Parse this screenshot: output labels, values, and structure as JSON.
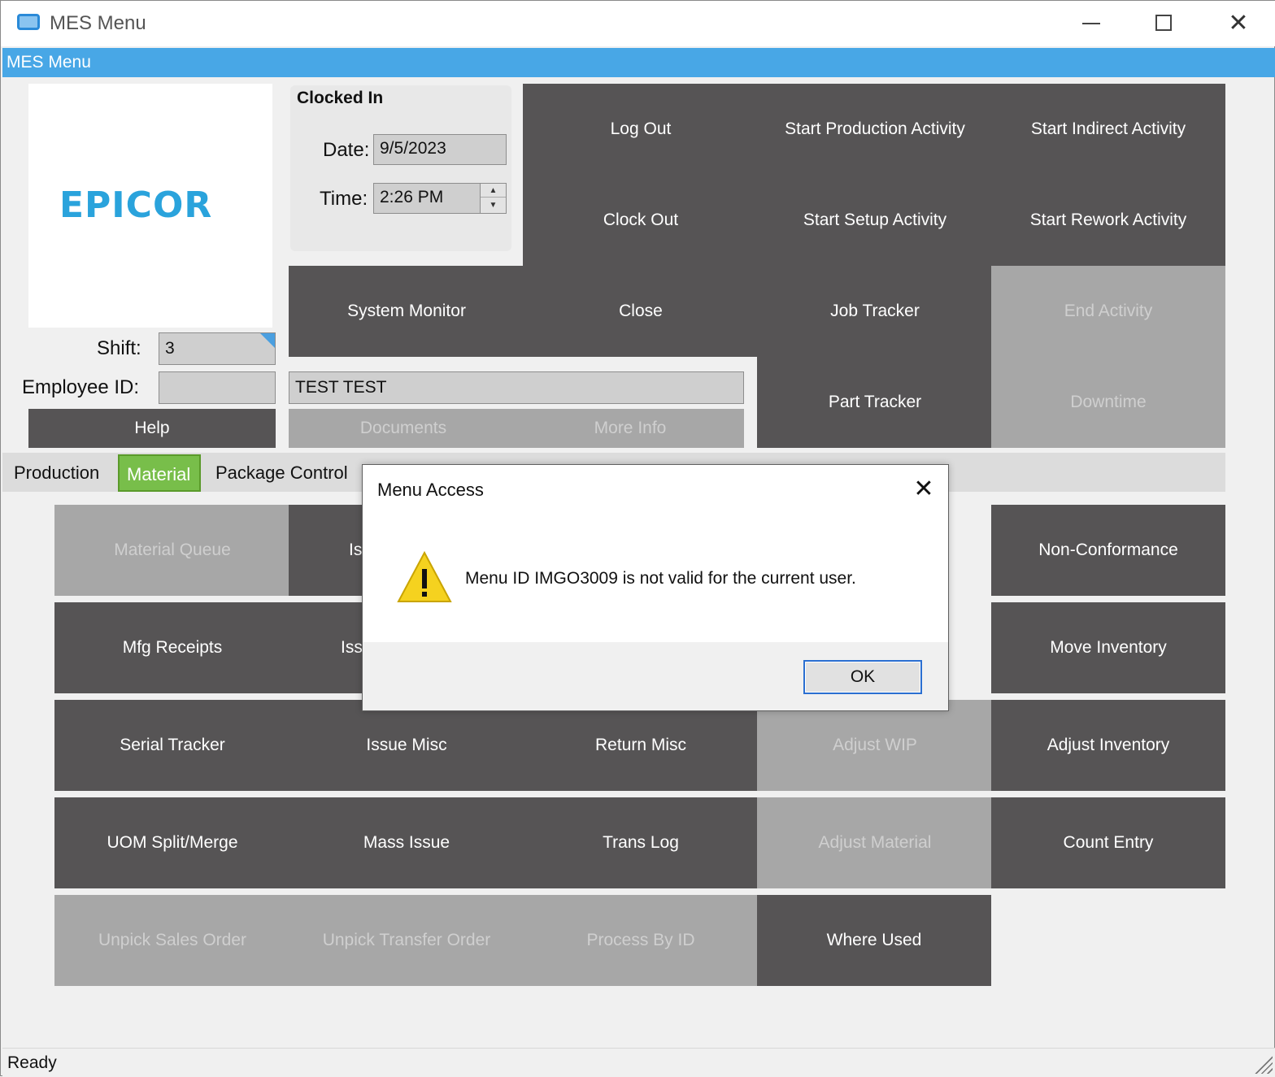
{
  "window": {
    "title": "MES Menu",
    "minimize_glyph": "",
    "maximize_glyph": "",
    "close_glyph": "✕"
  },
  "menustrip": {
    "label": "MES Menu"
  },
  "logo": {
    "text": "EPICOR"
  },
  "clock": {
    "title": "Clocked In",
    "date_label": "Date:",
    "date_value": "9/5/2023",
    "time_label": "Time:",
    "time_value": "2:26 PM",
    "spin_up": "▲",
    "spin_down": "▼"
  },
  "employee": {
    "shift_label": "Shift:",
    "shift_value": "3",
    "employee_id_label": "Employee ID:",
    "employee_id_value": "",
    "employee_name": "TEST TEST"
  },
  "top_buttons": {
    "log_out": "Log Out",
    "start_production": "Start Production Activity",
    "start_indirect": "Start Indirect Activity",
    "clock_out": "Clock Out",
    "start_setup": "Start Setup Activity",
    "start_rework": "Start Rework Activity",
    "system_monitor": "System Monitor",
    "close": "Close",
    "job_tracker": "Job Tracker",
    "end_activity": "End Activity",
    "part_tracker": "Part Tracker",
    "downtime": "Downtime",
    "help": "Help",
    "documents": "Documents",
    "more_info": "More Info"
  },
  "tabs": {
    "production": "Production",
    "material": "Material",
    "package_control": "Package Control"
  },
  "material_buttons": {
    "material_queue": "Material Queue",
    "issue_partial_1": "Is",
    "non_conformance": "Non-Conformance",
    "mfg_receipts": "Mfg Receipts",
    "issue_partial_2": "Iss",
    "move_inventory": "Move Inventory",
    "serial_tracker": "Serial Tracker",
    "issue_misc": "Issue Misc",
    "return_misc": "Return Misc",
    "adjust_wip": "Adjust WIP",
    "adjust_inventory": "Adjust Inventory",
    "uom_split_merge": "UOM Split/Merge",
    "mass_issue": "Mass Issue",
    "trans_log": "Trans Log",
    "adjust_material": "Adjust Material",
    "count_entry": "Count Entry",
    "unpick_sales_order": "Unpick Sales Order",
    "unpick_transfer_order": "Unpick Transfer Order",
    "process_by_id": "Process By ID",
    "where_used": "Where Used"
  },
  "status": {
    "text": "Ready"
  },
  "dialog": {
    "title": "Menu Access",
    "close_glyph": "✕",
    "message": "Menu ID IMGO3009 is not valid for the current user.",
    "ok_label": "OK"
  },
  "colors": {
    "tile_dark": "#565455",
    "tile_disabled": "#a7a7a7",
    "menustrip_blue": "#48a7e6",
    "tab_active_green": "#78be4a",
    "logo_blue": "#2aa3dc"
  }
}
